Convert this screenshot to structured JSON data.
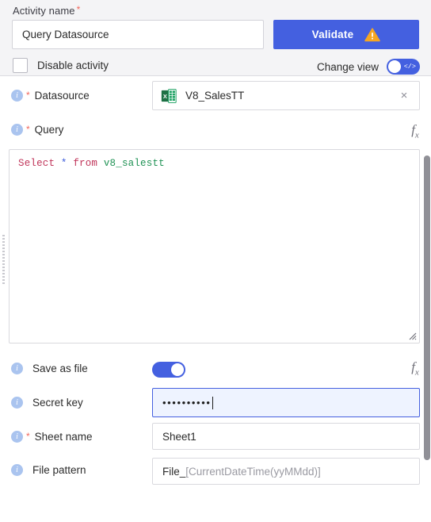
{
  "header": {
    "activity_name_label": "Activity name",
    "activity_name_value": "Query Datasource",
    "activity_name_placeholder": "Activity name",
    "required_marker": "*",
    "validate_label": "Validate",
    "warning_icon": "warning-triangle-icon",
    "disable_activity_label": "Disable activity",
    "disable_activity_checked": false,
    "change_view_label": "Change view",
    "change_view_toggle_on": false,
    "change_view_glyph": "</>"
  },
  "fields": {
    "datasource": {
      "label": "Datasource",
      "required": "*",
      "info_icon": "i",
      "value": "V8_SalesTT",
      "file_icon": "excel-file-icon",
      "clear_icon": "×"
    },
    "query": {
      "label": "Query",
      "required": "*",
      "info_icon": "i",
      "fx_icon": "f",
      "fx_sub": "x",
      "code_keyword_1": "Select",
      "code_star": "*",
      "code_keyword_2": "from",
      "code_table": "v8_salestt",
      "code_full": "Select * from v8_salestt"
    },
    "save_as_file": {
      "label": "Save as file",
      "info_icon": "i",
      "toggle_on": true,
      "fx_icon": "f",
      "fx_sub": "x"
    },
    "secret_key": {
      "label": "Secret key",
      "info_icon": "i",
      "value": "••••••••••",
      "focused": true
    },
    "sheet_name": {
      "label": "Sheet name",
      "required": "*",
      "info_icon": "i",
      "value": "Sheet1"
    },
    "file_pattern": {
      "label": "File pattern",
      "info_icon": "i",
      "value_prefix": "File_ ",
      "value_token": "[CurrentDateTime(yyMMdd)]"
    }
  },
  "colors": {
    "accent": "#4460e0",
    "warning": "#f5a623",
    "required": "#f2675c",
    "info_badge": "#aac4ef",
    "sql_keyword": "#c0355a",
    "sql_table": "#1f9254",
    "sql_operator": "#3b5bdb",
    "focus_fill": "#eef3ff"
  }
}
